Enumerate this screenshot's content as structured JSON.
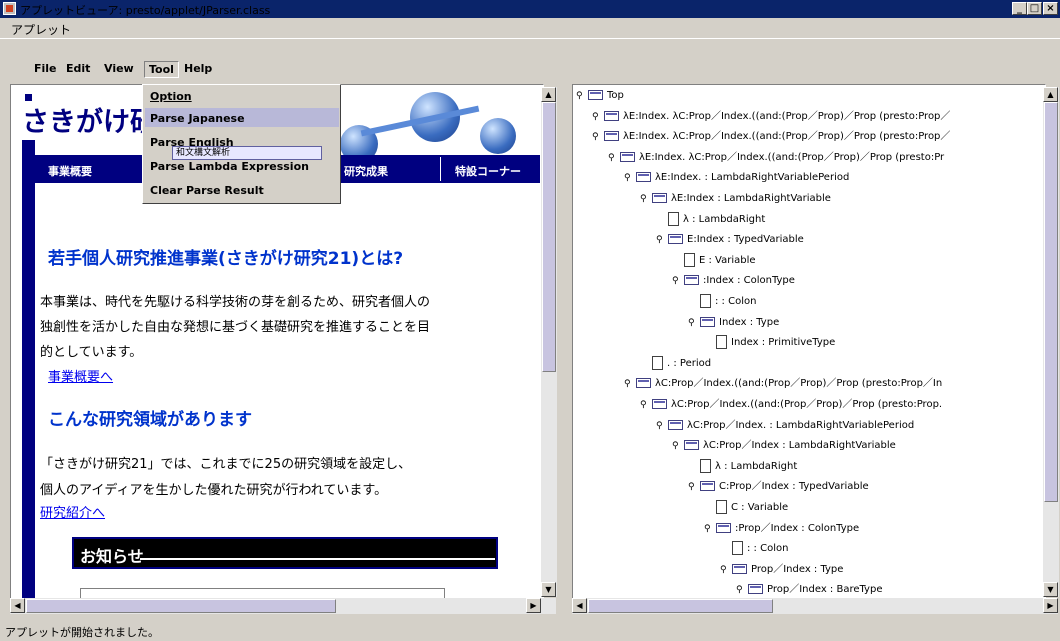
{
  "window": {
    "title": "アプレットビューア: presto/applet/JParser.class"
  },
  "applet_menu": "アプレット",
  "menubar": [
    {
      "label": "File"
    },
    {
      "label": "Edit"
    },
    {
      "label": "View"
    },
    {
      "label": "Tool"
    },
    {
      "label": "Help"
    }
  ],
  "tool_menu": [
    {
      "label": "Option"
    },
    {
      "label": "Parse Japanese"
    },
    {
      "label": "Parse English"
    },
    {
      "label": "Parse Lambda Expression"
    },
    {
      "label": "Clear Parse Result"
    }
  ],
  "ime_tooltip": "和文構文解析",
  "page": {
    "logo_text": "さきがけ研",
    "nav": [
      "事業概要",
      "研究成果",
      "特設コーナー"
    ],
    "heading1": "若手個人研究推進事業(さきがけ研究21)とは?",
    "para1": [
      "本事業は、時代を先駆ける科学技術の芽を創るため、研究者個人の",
      "独創性を活かした自由な発想に基づく基礎研究を推進することを目",
      "的としています。"
    ],
    "link1": "事業概要へ",
    "heading2": "こんな研究領域があります",
    "para2": [
      "「さきがけ研究21」では、これまでに25の研究領域を設定し、",
      "個人のアイディアを生かした優れた研究が行われています。"
    ],
    "link2": "研究紹介へ",
    "notice": "お知らせ"
  },
  "tree": [
    {
      "depth": 0,
      "type": "folder",
      "label": "Top"
    },
    {
      "depth": 1,
      "type": "folder",
      "label": "λE:Index. λC:Prop／Index.((and:(Prop／Prop)／Prop (presto:Prop／"
    },
    {
      "depth": 1,
      "type": "folder",
      "label": "λE:Index. λC:Prop／Index.((and:(Prop／Prop)／Prop (presto:Prop／"
    },
    {
      "depth": 2,
      "type": "folder",
      "label": "λE:Index. λC:Prop／Index.((and:(Prop／Prop)／Prop (presto:Pr"
    },
    {
      "depth": 3,
      "type": "folder",
      "label": "λE:Index. : LambdaRightVariablePeriod"
    },
    {
      "depth": 4,
      "type": "folder",
      "label": "λE:Index : LambdaRightVariable"
    },
    {
      "depth": 5,
      "type": "leaf",
      "label": "λ : LambdaRight"
    },
    {
      "depth": 5,
      "type": "folder",
      "label": "E:Index : TypedVariable"
    },
    {
      "depth": 6,
      "type": "leaf",
      "label": "E : Variable"
    },
    {
      "depth": 6,
      "type": "folder",
      "label": ":Index : ColonType"
    },
    {
      "depth": 7,
      "type": "leaf",
      "label": ": : Colon"
    },
    {
      "depth": 7,
      "type": "folder",
      "label": "Index : Type"
    },
    {
      "depth": 8,
      "type": "leaf",
      "label": "Index : PrimitiveType"
    },
    {
      "depth": 4,
      "type": "leaf",
      "label": ". : Period"
    },
    {
      "depth": 3,
      "type": "folder",
      "label": "λC:Prop／Index.((and:(Prop／Prop)／Prop (presto:Prop／In"
    },
    {
      "depth": 4,
      "type": "folder",
      "label": "λC:Prop／Index.((and:(Prop／Prop)／Prop (presto:Prop."
    },
    {
      "depth": 5,
      "type": "folder",
      "label": "λC:Prop／Index. : LambdaRightVariablePeriod"
    },
    {
      "depth": 6,
      "type": "folder",
      "label": "λC:Prop／Index : LambdaRightVariable"
    },
    {
      "depth": 7,
      "type": "leaf",
      "label": "λ : LambdaRight"
    },
    {
      "depth": 7,
      "type": "folder",
      "label": "C:Prop／Index : TypedVariable"
    },
    {
      "depth": 8,
      "type": "leaf",
      "label": "C : Variable"
    },
    {
      "depth": 8,
      "type": "folder",
      "label": ":Prop／Index : ColonType"
    },
    {
      "depth": 9,
      "type": "leaf",
      "label": ": : Colon"
    },
    {
      "depth": 9,
      "type": "folder",
      "label": "Prop／Index : Type"
    },
    {
      "depth": 10,
      "type": "folder",
      "label": "Prop／Index : BareType"
    }
  ],
  "status": "アプレットが開始されました。"
}
